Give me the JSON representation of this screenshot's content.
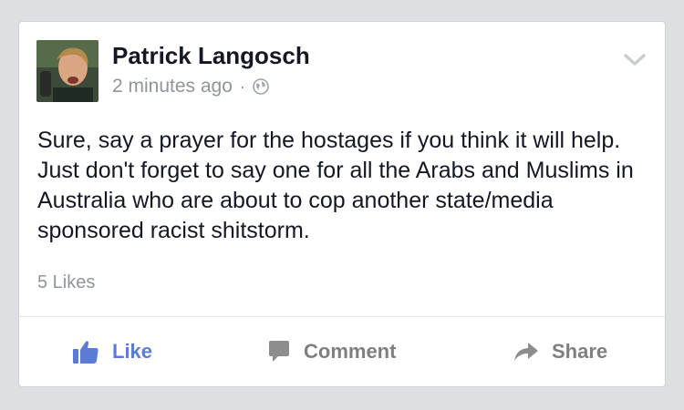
{
  "post": {
    "author": "Patrick Langosch",
    "timestamp": "2 minutes ago",
    "separator": "·",
    "privacy_icon": "globe-icon",
    "body": "Sure, say a prayer for the hostages if you think it will help. Just don't forget to say one for all the Arabs and Muslims in Australia who are about to cop another state/media sponsored racist shitstorm.",
    "likes": "5 Likes"
  },
  "actions": {
    "like": "Like",
    "comment": "Comment",
    "share": "Share"
  },
  "colors": {
    "background": "#dddfe3",
    "card": "#ffffff",
    "text": "#141823",
    "muted": "#90949c",
    "like_accent": "#5b7bd5",
    "action_gray": "#7f7f7f"
  }
}
